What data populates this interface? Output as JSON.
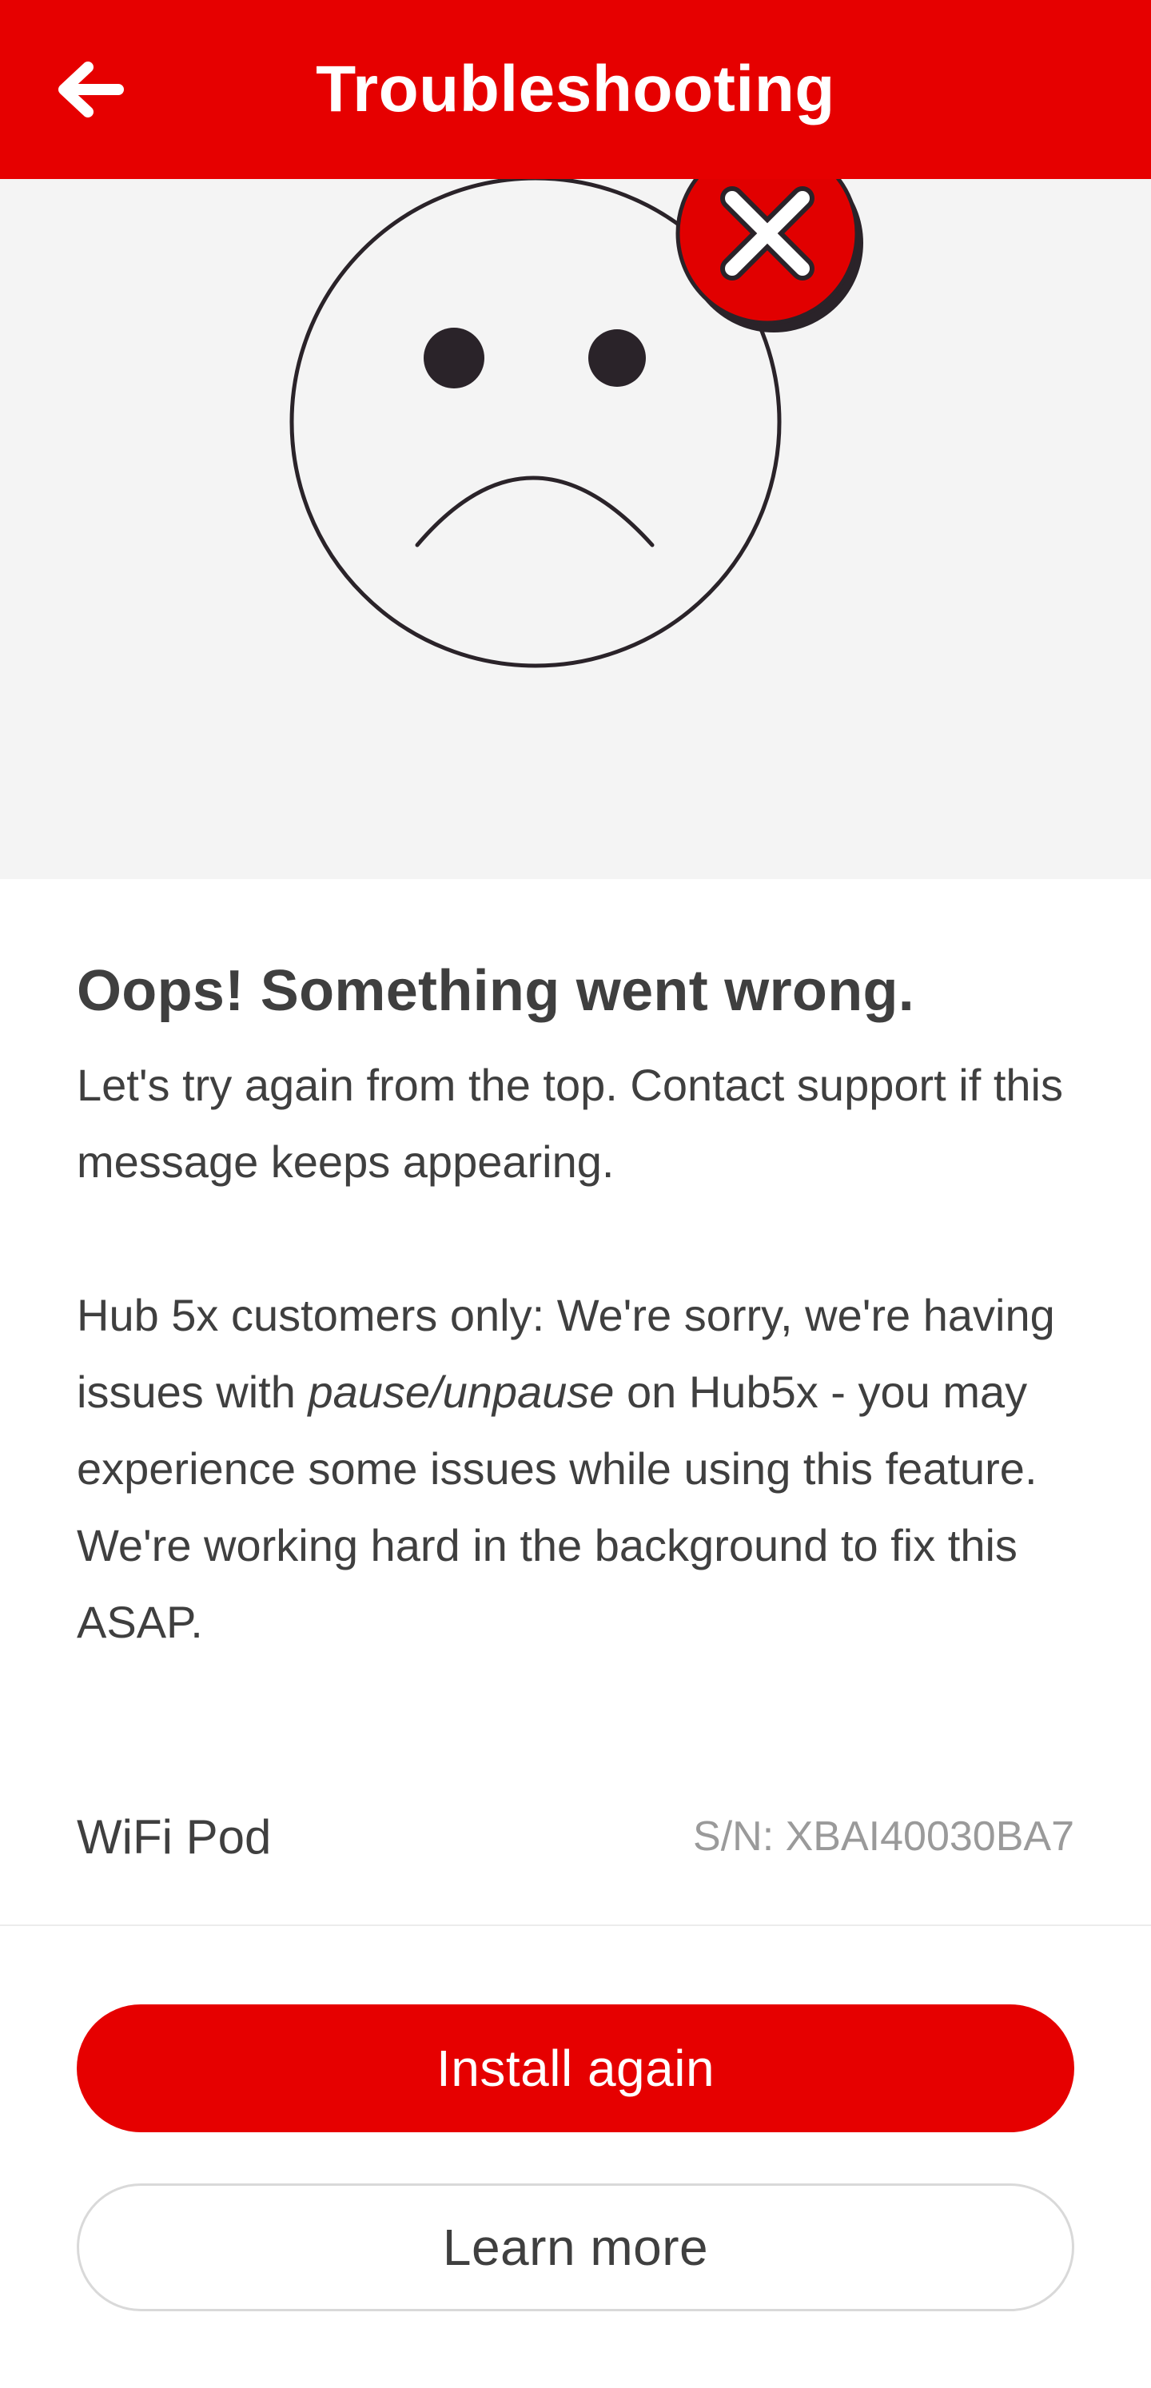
{
  "header": {
    "title": "Troubleshooting",
    "back_icon": "arrow-left-icon",
    "background_color": "#e60000"
  },
  "illustration": {
    "icon": "sad-face-icon",
    "badge_icon": "error-x-icon",
    "badge_color": "#e10000"
  },
  "error": {
    "title": "Oops! Something went wrong.",
    "message": "Let's try again from the top. Contact support if this message keeps appearing.",
    "notice_before": "Hub 5x customers only: We're sorry, we're having issues with ",
    "notice_emphasis": "pause/unpause",
    "notice_after": " on Hub5x - you may experience some issues while using this feature.",
    "notice_followup": "We're working hard in the background to fix this ASAP."
  },
  "device": {
    "name": "WiFi Pod",
    "serial": "S/N: XBAI40030BA7"
  },
  "actions": {
    "primary_label": "Install again",
    "secondary_label": "Learn more"
  }
}
